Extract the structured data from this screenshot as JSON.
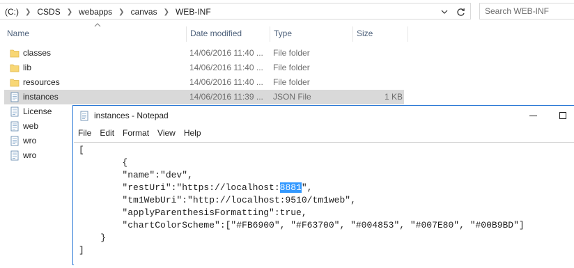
{
  "address": {
    "path": [
      "(C:)",
      "CSDS",
      "webapps",
      "canvas",
      "WEB-INF"
    ],
    "search_placeholder": "Search WEB-INF"
  },
  "columns": {
    "name": "Name",
    "date": "Date modified",
    "type": "Type",
    "size": "Size"
  },
  "files": [
    {
      "name": "classes",
      "date": "14/06/2016 11:40 ...",
      "type": "File folder",
      "size": "",
      "icon": "folder-icon"
    },
    {
      "name": "lib",
      "date": "14/06/2016 11:40 ...",
      "type": "File folder",
      "size": "",
      "icon": "folder-icon"
    },
    {
      "name": "resources",
      "date": "14/06/2016 11:40 ...",
      "type": "File folder",
      "size": "",
      "icon": "folder-icon"
    },
    {
      "name": "instances",
      "date": "14/06/2016 11:39 ...",
      "type": "JSON File",
      "size": "1 KB",
      "icon": "document-icon",
      "selected": true
    },
    {
      "name": "License",
      "date": "",
      "type": "",
      "size": "",
      "icon": "document-icon"
    },
    {
      "name": "web",
      "date": "",
      "type": "",
      "size": "",
      "icon": "document-icon"
    },
    {
      "name": "wro",
      "date": "",
      "type": "",
      "size": "",
      "icon": "document-icon"
    },
    {
      "name": "wro",
      "date": "",
      "type": "",
      "size": "",
      "icon": "document-icon"
    }
  ],
  "notepad": {
    "title": "instances - Notepad",
    "menu": [
      "File",
      "Edit",
      "Format",
      "View",
      "Help"
    ],
    "content_before": "[\n        {\n        \"name\":\"dev\",\n        \"restUri\":\"https://localhost:",
    "selected_text": "8881",
    "content_after": "\",\n        \"tm1WebUri\":\"http://localhost:9510/tm1web\",\n        \"applyParenthesisFormatting\":true,\n        \"chartColorScheme\":[\"#FB6900\", \"#F63700\", \"#004853\", \"#007E80\", \"#00B9BD\"]\n    }\n]"
  },
  "colors": {
    "selection_row": "#d9d9d9",
    "text_highlight": "#3399ff",
    "window_border": "#2b79d6",
    "folder": "#f8d775"
  }
}
